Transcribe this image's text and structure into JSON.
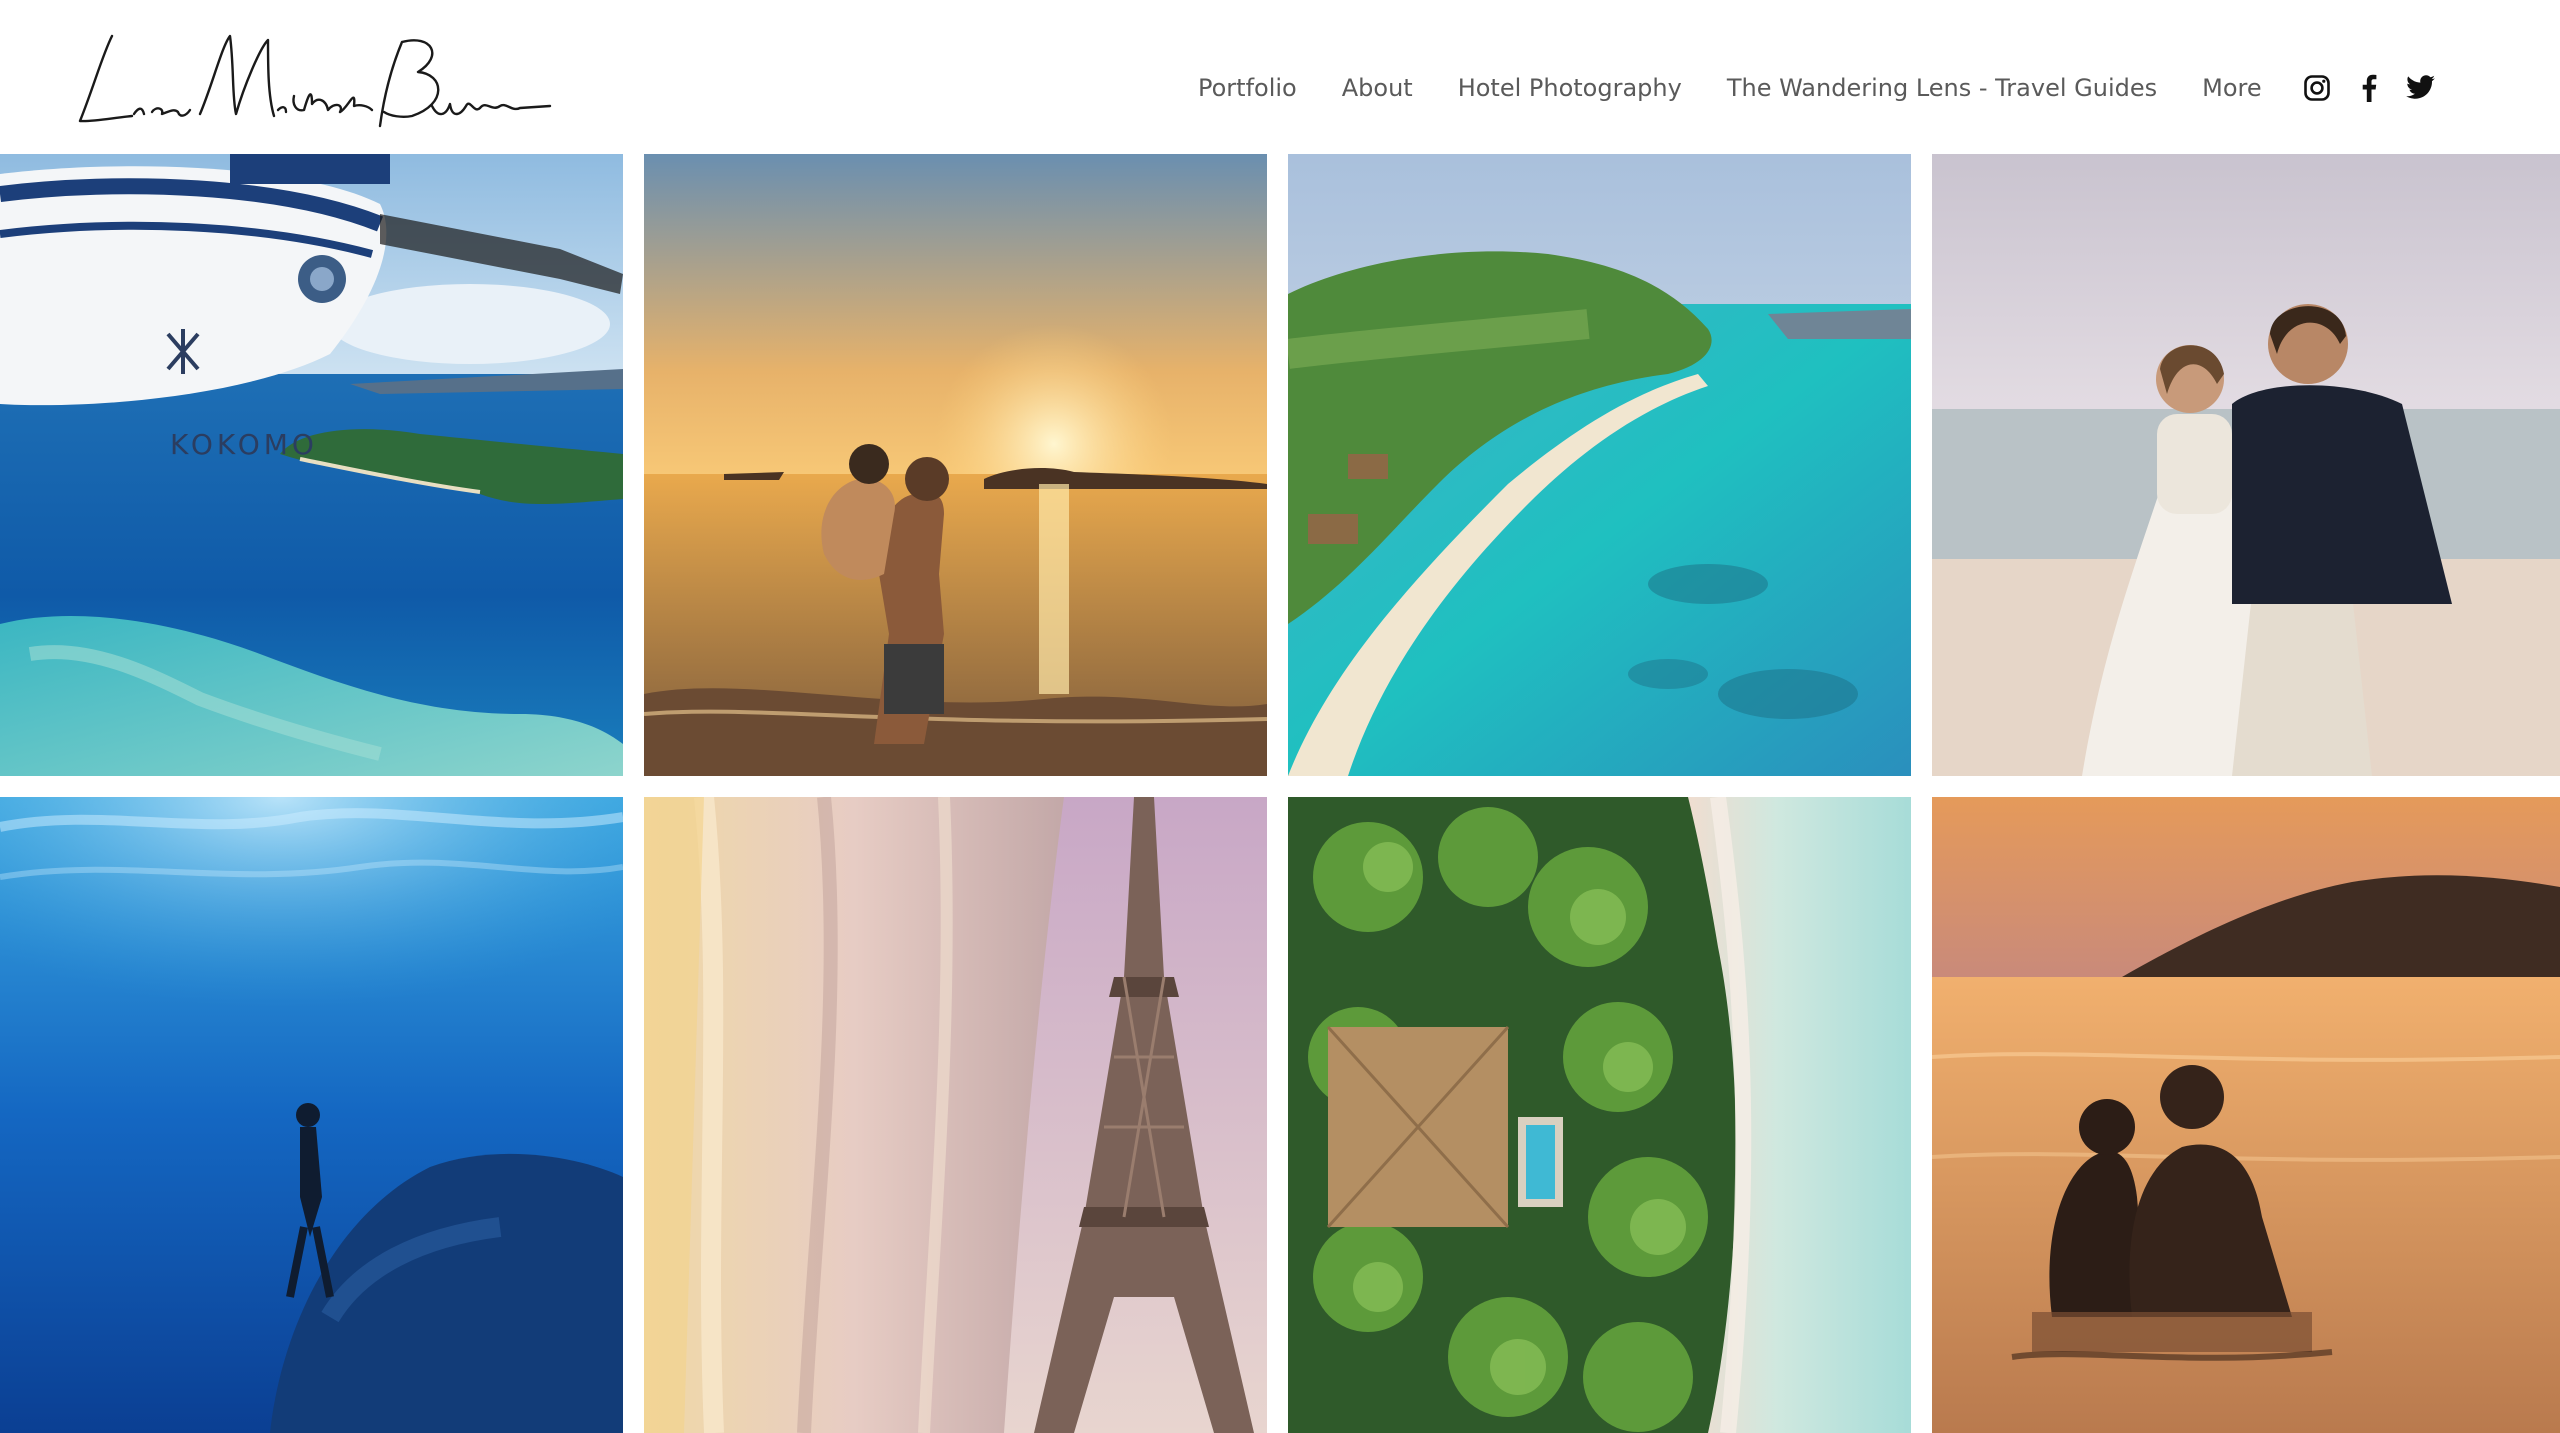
{
  "header": {
    "logo_alt": "Lisa Michele Burns signature logo"
  },
  "nav": {
    "items": [
      {
        "label": "Portfolio"
      },
      {
        "label": "About"
      },
      {
        "label": "Hotel Photography"
      },
      {
        "label": "The Wandering Lens - Travel Guides"
      },
      {
        "label": "More"
      }
    ],
    "social": [
      "instagram-icon",
      "facebook-icon",
      "twitter-icon"
    ]
  },
  "gallery": {
    "tiles": [
      {
        "subject": "seaplane wing over tropical island",
        "text": "KOKOMO"
      },
      {
        "subject": "couple piggyback at sunset on beach"
      },
      {
        "subject": "aerial view of island beach and lagoon"
      },
      {
        "subject": "bride and groom on beach"
      },
      {
        "subject": "freediver underwater near reef"
      },
      {
        "subject": "Eiffel Tower through curtain"
      },
      {
        "subject": "aerial view of villa with pool among palms"
      },
      {
        "subject": "couple silhouette in sunset water"
      }
    ]
  },
  "colors": {
    "nav_text": "#5a5a5a",
    "background": "#ffffff"
  }
}
